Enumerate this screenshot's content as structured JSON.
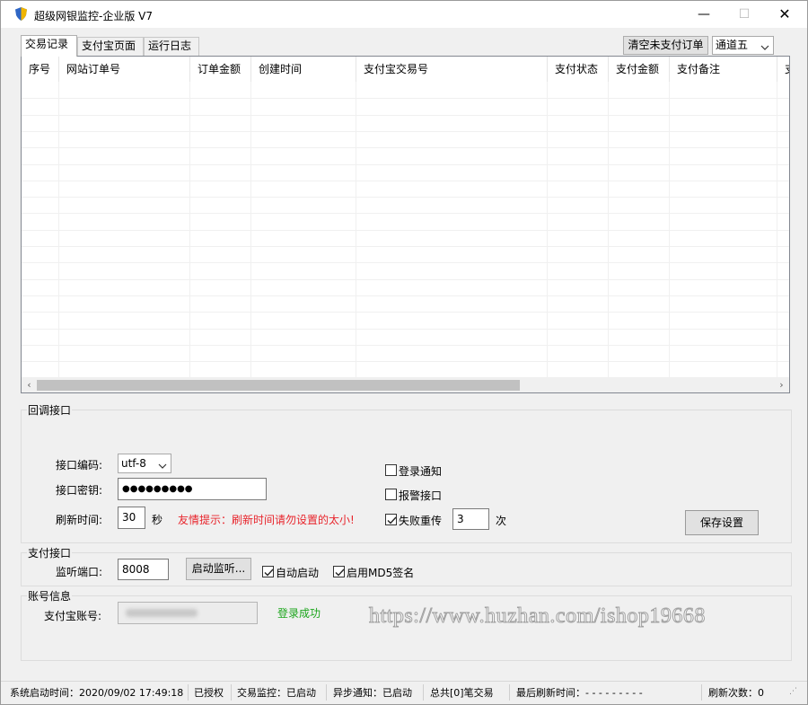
{
  "window": {
    "title": "超级网银监控-企业版 V7",
    "controls": {
      "minimize": "—",
      "maximize": "☐",
      "close": "✕"
    }
  },
  "tabs": [
    {
      "label": "交易记录",
      "active": true
    },
    {
      "label": "支付宝页面",
      "active": false
    },
    {
      "label": "运行日志",
      "active": false
    }
  ],
  "toolbar": {
    "clear_button": "清空未支付订单",
    "channel_select": "通道五"
  },
  "table": {
    "columns": [
      "序号",
      "网站订单号",
      "订单金额",
      "创建时间",
      "支付宝交易号",
      "支付状态",
      "支付金额",
      "支付备注",
      "支"
    ],
    "rows": [],
    "scroll_left": "‹",
    "scroll_right": "›"
  },
  "callback_group": {
    "title": "回调接口",
    "encoding_label": "接口编码:",
    "encoding_value": "utf-8",
    "secret_label": "接口密钥:",
    "secret_value": "●●●●●●●●●",
    "refresh_label": "刷新时间:",
    "refresh_value": "30",
    "refresh_unit": "秒",
    "tip": "友情提示：刷新时间请勿设置的太小!",
    "tip_color": "#e8242b",
    "login_notify": {
      "label": "登录通知",
      "checked": false
    },
    "alarm_api": {
      "label": "报警接口",
      "checked": false
    },
    "retry": {
      "label": "失败重传",
      "checked": true
    },
    "retry_count": "3",
    "retry_unit": "次",
    "save_button": "保存设置"
  },
  "payment_group": {
    "title": "支付接口",
    "port_label": "监听端口:",
    "port_value": "8008",
    "start_button": "启动监听...",
    "auto_start": {
      "label": "自动启动",
      "checked": true
    },
    "md5_sign": {
      "label": "启用MD5签名",
      "checked": true
    }
  },
  "account_group": {
    "title": "账号信息",
    "account_label": "支付宝账号:",
    "login_status": "登录成功",
    "login_status_color": "#1aa51a"
  },
  "watermark": "https://www.huzhan.com/ishop19668",
  "status_bar": {
    "start_time": "系统启动时间：2020/09/02 17:49:18",
    "auth": "已授权",
    "trade_monitor": "交易监控：已启动",
    "async_notify": "异步通知：已启动",
    "total": "总共[0]笔交易",
    "last_refresh": "最后刷新时间：- - - - - - - - -",
    "refresh_count": "刷新次数：0"
  }
}
